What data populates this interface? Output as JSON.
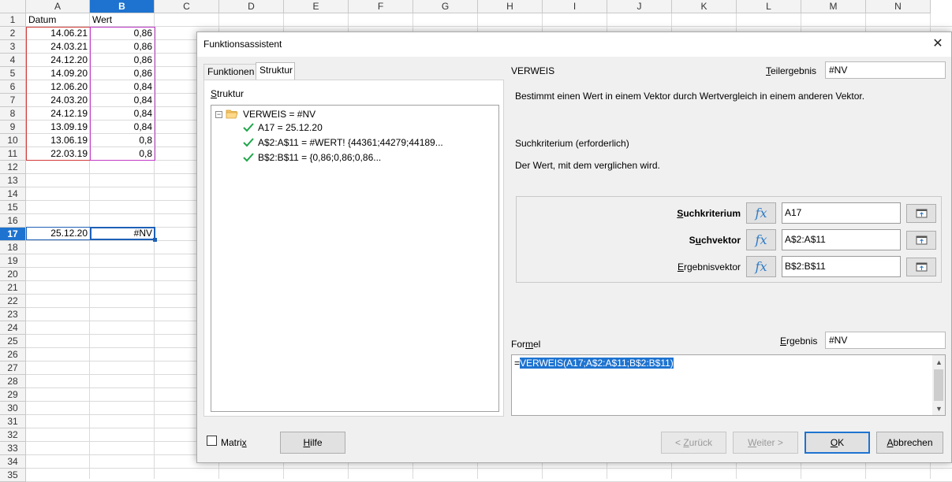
{
  "spreadsheet": {
    "columns": [
      "A",
      "B",
      "C",
      "D",
      "E",
      "F",
      "G",
      "H",
      "I",
      "J",
      "K",
      "L",
      "M",
      "N"
    ],
    "rows": [
      "1",
      "2",
      "3",
      "4",
      "5",
      "6",
      "7",
      "8",
      "9",
      "10",
      "11",
      "12",
      "13",
      "14",
      "15",
      "16",
      "17",
      "18",
      "19",
      "20",
      "21",
      "22",
      "23",
      "24",
      "25",
      "26",
      "27",
      "28",
      "29",
      "30",
      "31",
      "32",
      "33",
      "34",
      "35"
    ],
    "header_row": {
      "a": "Datum",
      "b": "Wert"
    },
    "data": [
      {
        "a": "14.06.21",
        "b": "0,86"
      },
      {
        "a": "24.03.21",
        "b": "0,86"
      },
      {
        "a": "24.12.20",
        "b": "0,86"
      },
      {
        "a": "14.09.20",
        "b": "0,86"
      },
      {
        "a": "12.06.20",
        "b": "0,84"
      },
      {
        "a": "24.03.20",
        "b": "0,84"
      },
      {
        "a": "24.12.19",
        "b": "0,84"
      },
      {
        "a": "13.09.19",
        "b": "0,84"
      },
      {
        "a": "13.06.19",
        "b": "0,8"
      },
      {
        "a": "22.03.19",
        "b": "0,8"
      }
    ],
    "row17": {
      "a": "25.12.20",
      "b": "#NV"
    }
  },
  "dialog": {
    "title": "Funktionsassistent",
    "tabs": [
      "Funktionen",
      "Struktur"
    ],
    "struktur_label": "Struktur",
    "tree": {
      "root": "VERWEIS = #NV",
      "children": [
        "A17 = 25.12.20",
        "A$2:A$11 = #WERT!  {44361;44279;44189...",
        "B$2:B$11 = {0,86;0,86;0,86..."
      ]
    },
    "function_name": "VERWEIS",
    "teilergebnis_label": "Teilergebnis",
    "teilergebnis_value": "#NV",
    "description": "Bestimmt einen Wert in einem Vektor durch Wertvergleich in einem anderen Vektor.",
    "param_title": "Suchkriterium (erforderlich)",
    "param_desc": "Der Wert, mit dem verglichen wird.",
    "args": [
      {
        "label": "Suchkriterium",
        "value": "A17",
        "bold": true
      },
      {
        "label": "Suchvektor",
        "value": "A$2:A$11",
        "bold": true
      },
      {
        "label": "Ergebnisvektor",
        "value": "B$2:B$11",
        "bold": false
      }
    ],
    "fx_glyph": "fx",
    "formel_label": "Formel",
    "ergebnis_label": "Ergebnis",
    "ergebnis_value": "#NV",
    "formula_prefix": "=",
    "formula_selected": "VERWEIS(A17;A$2:A$11;B$2:B$11)",
    "matrix_label": "Matrix",
    "buttons": {
      "hilfe": "Hilfe",
      "zurueck": "< Zurück",
      "weiter": "Weiter >",
      "ok": "OK",
      "abbrechen": "Abbrechen"
    },
    "close_glyph": "✕"
  },
  "colors": {
    "selection": "#1e73d0",
    "range_a": "#d23a3a",
    "range_b": "#c13ac9",
    "check": "#1fa64a",
    "fx": "#2e7bc6"
  }
}
